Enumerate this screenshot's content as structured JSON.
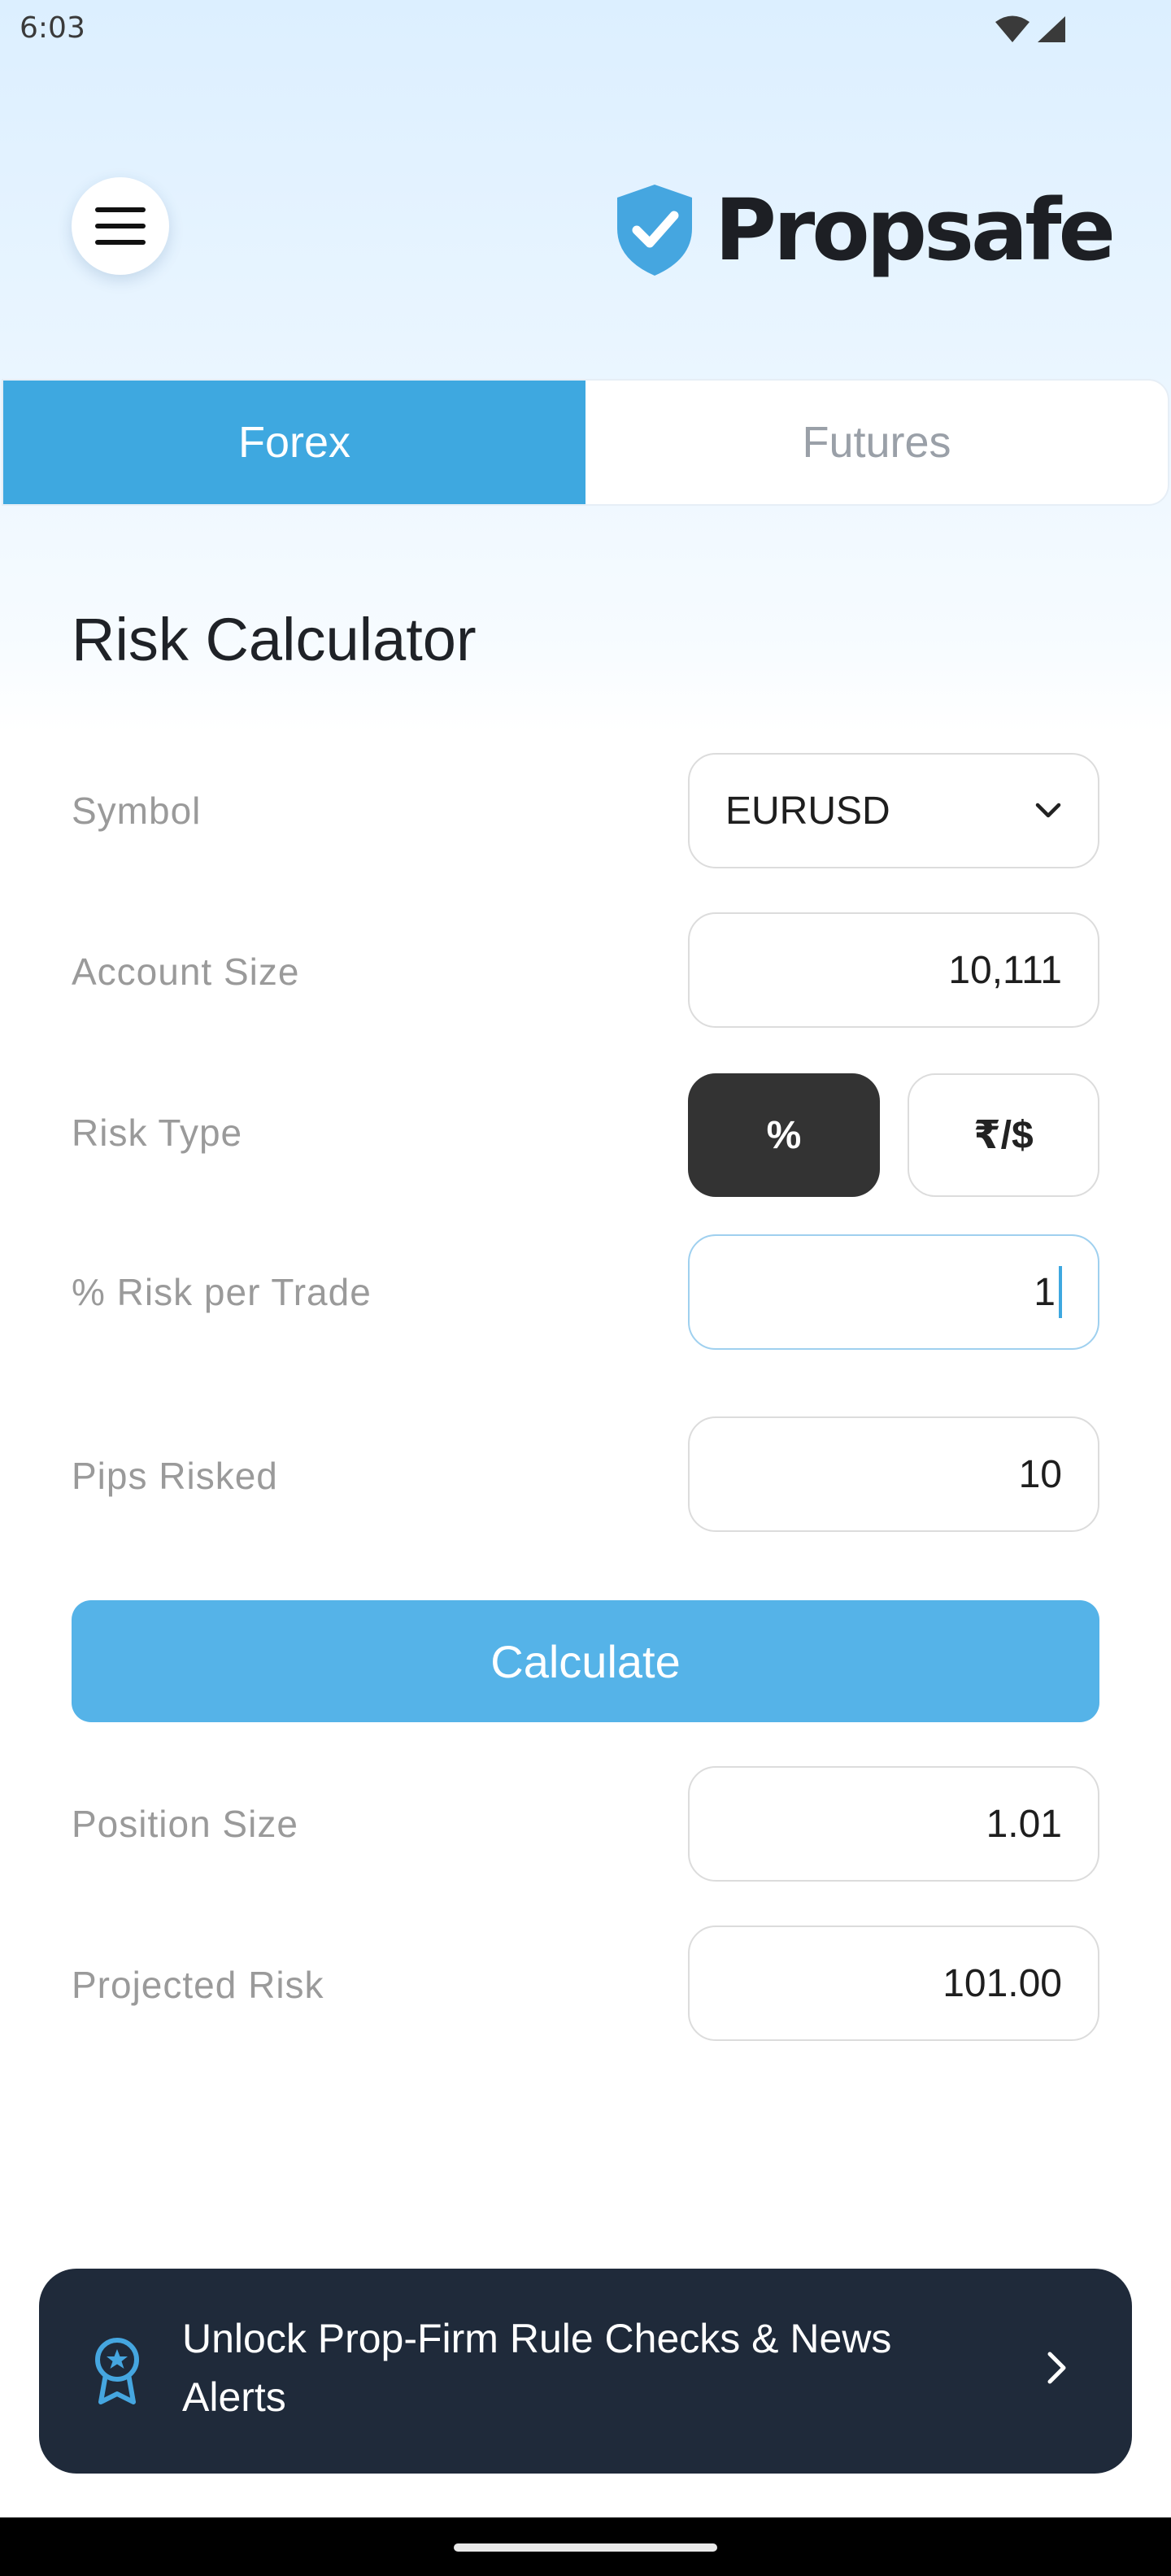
{
  "status_bar": {
    "time": "6:03",
    "icons": [
      "wifi-icon",
      "cellular-signal-icon"
    ]
  },
  "header": {
    "menu_icon": "hamburger-menu-icon",
    "logo_icon": "shield-check-icon",
    "logo_text": "Propsafe"
  },
  "tabs": [
    {
      "label": "Forex",
      "active": true
    },
    {
      "label": "Futures",
      "active": false
    }
  ],
  "calculator": {
    "title": "Risk Calculator",
    "symbol_label": "Symbol",
    "symbol_value": "EURUSD",
    "account_size_label": "Account Size",
    "account_size_value": "10,111",
    "risk_type_label": "Risk Type",
    "risk_type_options": [
      "%",
      "₹/$"
    ],
    "risk_type_selected": "%",
    "risk_per_trade_label": "% Risk per Trade",
    "risk_per_trade_value": "1",
    "pips_risked_label": "Pips Risked",
    "pips_risked_value": "10",
    "calculate_label": "Calculate",
    "position_size_label": "Position Size",
    "position_size_value": "1.01",
    "projected_risk_label": "Projected Risk",
    "projected_risk_value": "101.00"
  },
  "banner": {
    "icon": "award-badge-icon",
    "text": "Unlock Prop-Firm Rule Checks & News Alerts",
    "chevron": "chevron-right-icon"
  },
  "colors": {
    "accent": "#3ea8e0",
    "button": "#55b3e8",
    "banner_bg": "#1f2a3a",
    "segment_active": "#333333"
  }
}
